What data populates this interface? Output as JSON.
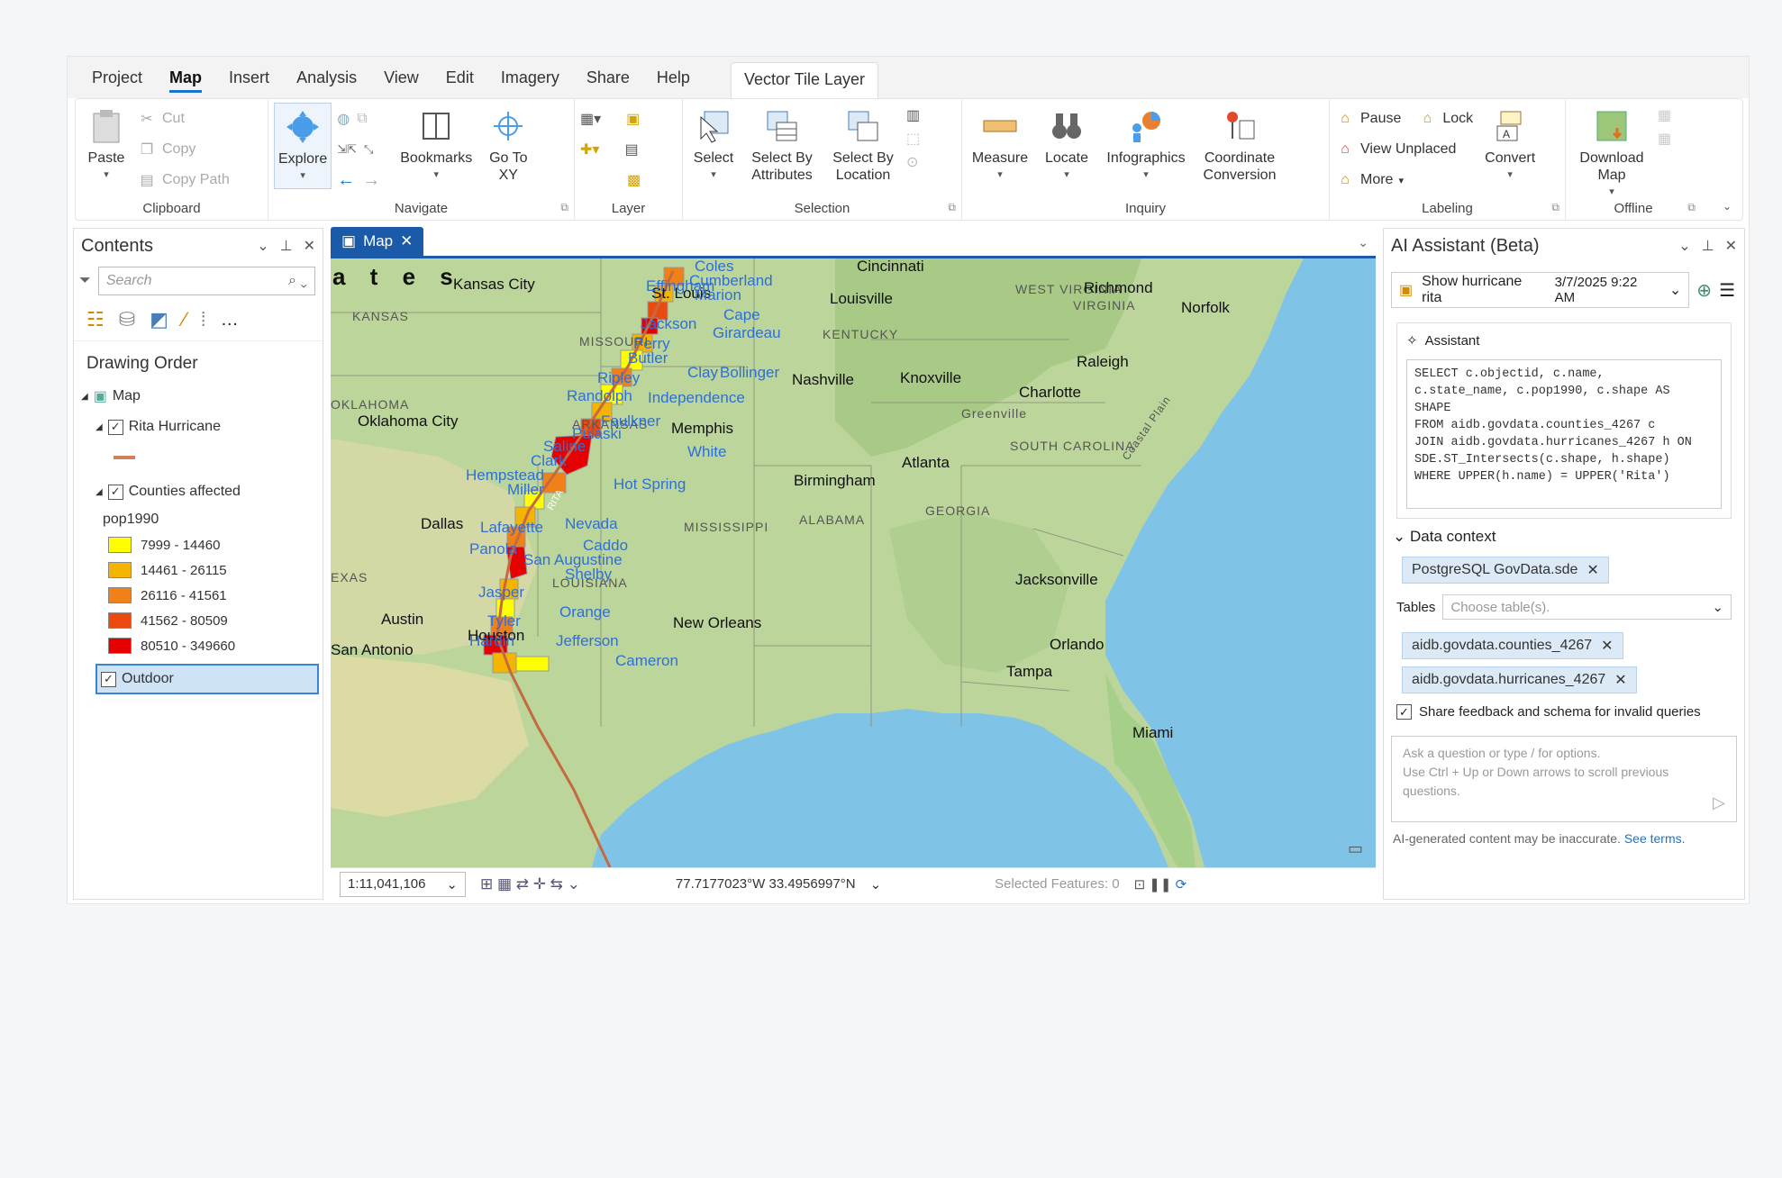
{
  "menu": {
    "tabs": [
      "Project",
      "Map",
      "Insert",
      "Analysis",
      "View",
      "Edit",
      "Imagery",
      "Share",
      "Help"
    ],
    "active": "Map",
    "context_tab": "Vector Tile Layer"
  },
  "ribbon": {
    "clipboard": {
      "label": "Clipboard",
      "paste": "Paste",
      "cut": "Cut",
      "copy": "Copy",
      "copy_path": "Copy Path"
    },
    "navigate": {
      "label": "Navigate",
      "explore": "Explore",
      "bookmarks": "Bookmarks",
      "goto": "Go To XY"
    },
    "layer": {
      "label": "Layer"
    },
    "selection": {
      "label": "Selection",
      "select": "Select",
      "by_attr": "Select By Attributes",
      "by_loc": "Select By Location"
    },
    "inquiry": {
      "label": "Inquiry",
      "measure": "Measure",
      "locate": "Locate",
      "infographics": "Infographics",
      "coord": "Coordinate Conversion"
    },
    "labeling": {
      "label": "Labeling",
      "pause": "Pause",
      "lock": "Lock",
      "view_unplaced": "View Unplaced",
      "more": "More",
      "convert": "Convert"
    },
    "offline": {
      "label": "Offline",
      "download": "Download Map"
    }
  },
  "contents": {
    "title": "Contents",
    "search_placeholder": "Search",
    "drawing_order": "Drawing Order",
    "map": "Map",
    "layer1": "Rita Hurricane",
    "layer2": "Counties affected",
    "field": "pop1990",
    "legend": [
      {
        "label": "7999 - 14460",
        "color": "#ffff00"
      },
      {
        "label": "14461 - 26115",
        "color": "#f5b400"
      },
      {
        "label": "26116 - 41561",
        "color": "#f08018"
      },
      {
        "label": "41562 - 80509",
        "color": "#ea4a10"
      },
      {
        "label": "80510 - 349660",
        "color": "#e60000"
      }
    ],
    "basemap": "Outdoor"
  },
  "map": {
    "tab": "Map",
    "scale": "1:11,041,106",
    "coords": "77.7177023°W 33.4956997°N",
    "selected": "Selected Features: 0",
    "labels": {
      "states_partial": "a t e s",
      "kansas_city": "Kansas City",
      "kansas": "KANSAS",
      "oklahoma": "OKLAHOMA",
      "oklahoma_city": "Oklahoma City",
      "dallas": "Dallas",
      "texas": "EXAS",
      "austin": "Austin",
      "san_antonio": "San Antonio",
      "houston": "Houston",
      "st_louis": "St. Louis",
      "missouri": "MISSOURI",
      "arkansas": "ARKANSAS",
      "louisiana": "LOUISIANA",
      "mississippi": "MISSISSIPPI",
      "alabama": "ALABAMA",
      "georgia": "GEORGIA",
      "kentucky": "KENTUCKY",
      "west_virginia": "WEST VIRGINIA",
      "virginia": "VIRGINIA",
      "south_carolina": "SOUTH CAROLINA",
      "cincinnati": "Cincinnati",
      "louisville": "Louisville",
      "richmond": "Richmond",
      "norfolk": "Norfolk",
      "raleigh": "Raleigh",
      "charlotte": "Charlotte",
      "greenville": "Greenville",
      "nashville": "Nashville",
      "knoxville": "Knoxville",
      "memphis": "Memphis",
      "atlanta": "Atlanta",
      "birmingham": "Birmingham",
      "jacksonville": "Jacksonville",
      "new_orleans": "New Orleans",
      "orlando": "Orlando",
      "tampa": "Tampa",
      "miami": "Miami",
      "coastal": "Coastal Plain",
      "coles": "Coles",
      "cumberland": "Cumberland",
      "effingham": "Effingham",
      "marion": "Marion",
      "jackson": "Jackson",
      "cape": "Cape",
      "girardeau": "Girardeau",
      "perry": "Perry",
      "butler": "Butler",
      "bollinger": "Bollinger",
      "ripley": "Ripley",
      "clay": "Clay",
      "randolph": "Randolph",
      "independence": "Independence",
      "faulkner": "Faulkner",
      "pulaski": "Pulaski",
      "white": "White",
      "saline": "Saline",
      "clark": "Clark",
      "hempstead": "Hempstead",
      "miller": "Miller",
      "hot_spring": "Hot Spring",
      "lafayette": "Lafayette",
      "nevada": "Nevada",
      "panola": "Panola",
      "caddo": "Caddo",
      "san_augustine": "San Augustine",
      "shelby": "Shelby",
      "jasper": "Jasper",
      "orange": "Orange",
      "tyler": "Tyler",
      "hardin": "Hardin",
      "jefferson": "Jefferson",
      "cameron": "Cameron",
      "rita": "RITA"
    }
  },
  "assistant": {
    "title": "AI Assistant (Beta)",
    "chat": "Show hurricane rita",
    "date": "3/7/2025 9:22 AM",
    "assistant_label": "Assistant",
    "sql": "SELECT c.objectid, c.name,\nc.state_name, c.pop1990, c.shape AS\nSHAPE\nFROM aidb.govdata.counties_4267 c\nJOIN aidb.govdata.hurricanes_4267 h ON\nSDE.ST_Intersects(c.shape, h.shape)\nWHERE UPPER(h.name) = UPPER('Rita')",
    "data_context": "Data context",
    "source": "PostgreSQL GovData.sde",
    "tables_label": "Tables",
    "tables_placeholder": "Choose table(s).",
    "table1": "aidb.govdata.counties_4267",
    "table2": "aidb.govdata.hurricanes_4267",
    "share_feedback": "Share feedback and schema for invalid queries",
    "input_placeholder": "Ask a question or type / for options.\nUse Ctrl + Up or Down arrows to scroll previous questions.",
    "disclaimer": "AI-generated content may be inaccurate.",
    "see_terms": "See terms."
  }
}
